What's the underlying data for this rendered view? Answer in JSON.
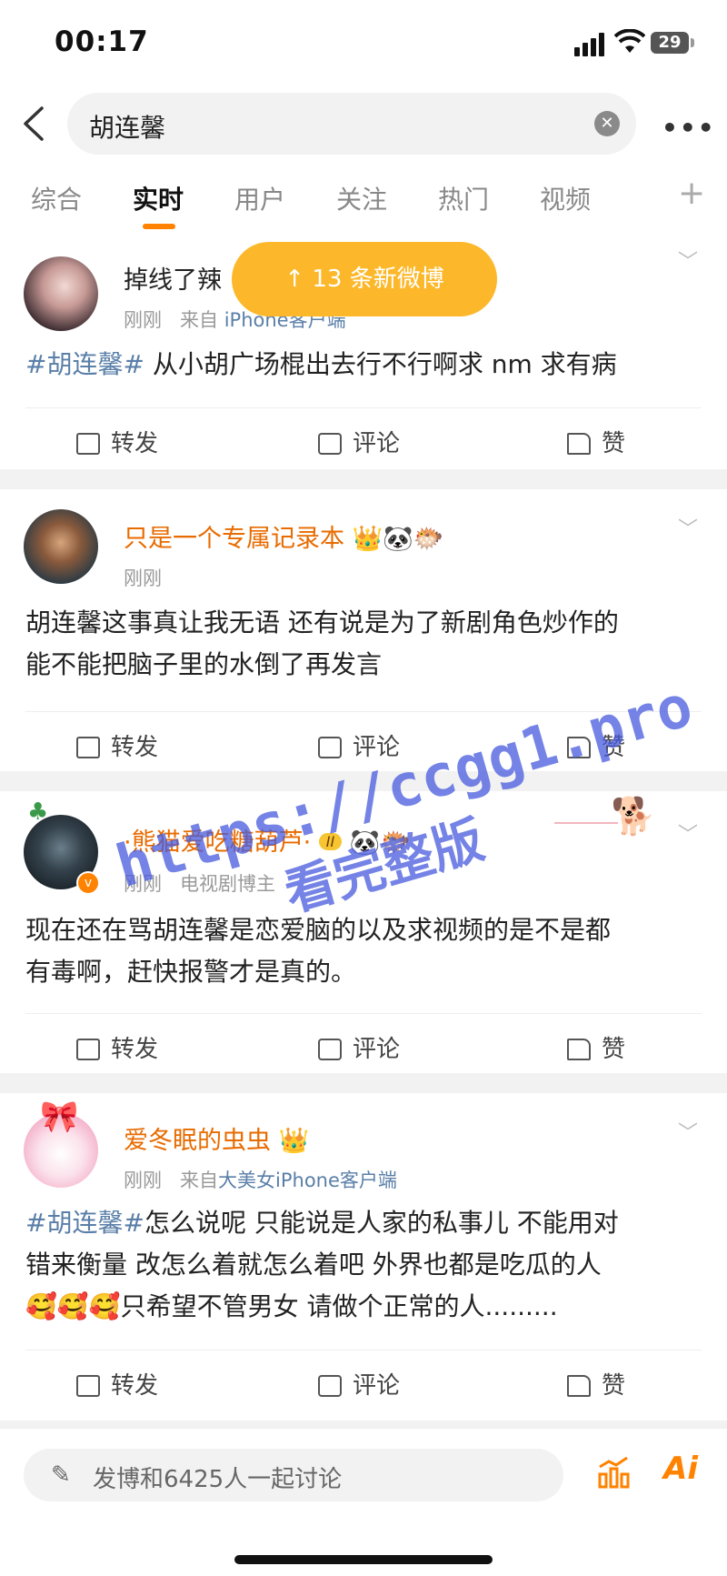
{
  "status": {
    "time": "00:17",
    "battery": "29"
  },
  "search": {
    "query": "胡连馨"
  },
  "tabs": [
    "综合",
    "实时",
    "用户",
    "关注",
    "热门",
    "视频"
  ],
  "banner": "↑ 13 条新微博",
  "posts": [
    {
      "user": "掉线了辣",
      "meta_time": "刚刚",
      "meta_from": "来自",
      "meta_source": "iPhone客户端",
      "tag": "#胡连馨#",
      "text": " 从小胡广场棍出去行不行啊求 nm 求有病",
      "actions": {
        "repost": "转发",
        "comment": "评论",
        "like": "赞"
      }
    },
    {
      "user": "只是一个专属记录本",
      "meta_time": "刚刚",
      "text_line1": "胡连馨这事真让我无语 还有说是为了新剧角色炒作的",
      "text_line2": "能不能把脑子里的水倒了再发言",
      "actions": {
        "repost": "转发",
        "comment": "评论",
        "like": "赞"
      }
    },
    {
      "user": "·熊猫爱吃糖葫芦·",
      "meta_time": "刚刚",
      "meta_role": "电视剧博主",
      "level_badge": "II",
      "text_line1": "现在还在骂胡连馨是恋爱脑的以及求视频的是不是都",
      "text_line2": "有毒啊，赶快报警才是真的。",
      "actions": {
        "repost": "转发",
        "comment": "评论",
        "like": "赞"
      }
    },
    {
      "user": "爱冬眠的虫虫",
      "meta_time": "刚刚",
      "meta_from": "来自",
      "meta_source": "大美女iPhone客户端",
      "tag": "#胡连馨#",
      "text_line1": "怎么说呢 只能说是人家的私事儿 不能用对",
      "text_line2": "错来衡量 改怎么着就怎么着吧 外界也都是吃瓜的人",
      "emojis": "🥰🥰🥰",
      "text_line3": "只希望不管男女 请做个正常的人.........",
      "actions": {
        "repost": "转发",
        "comment": "评论",
        "like": "赞"
      }
    }
  ],
  "watermark": {
    "line1": "https://ccgg1.pro",
    "line2": "看完整版"
  },
  "composer": {
    "placeholder": "发博和6425人一起讨论",
    "ai_label": "Ai"
  },
  "colors": {
    "accent": "#ff8200",
    "link": "#5a7fa8",
    "banner": "#fcb82a",
    "vip_name": "#e86b00"
  },
  "icons": [
    "back-arrow-icon",
    "clear-icon",
    "more-icon",
    "chevron-down-icon",
    "repost-icon",
    "comment-icon",
    "like-icon",
    "pencil-icon",
    "chart-icon"
  ]
}
